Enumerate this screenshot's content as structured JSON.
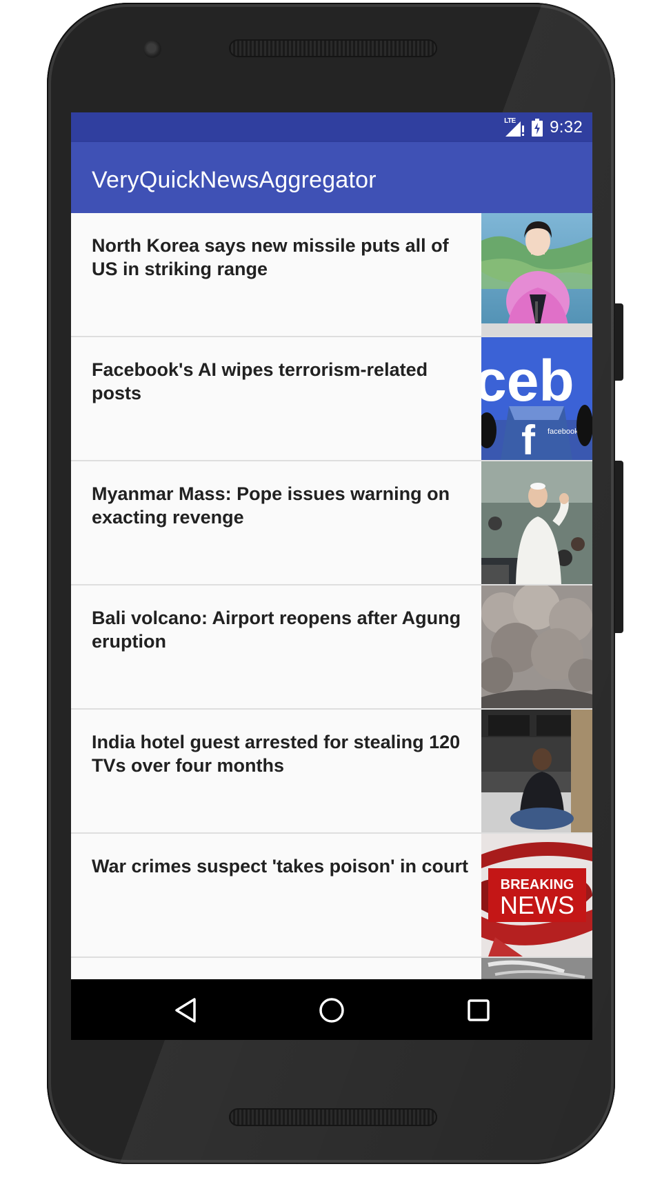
{
  "status_bar": {
    "network_label": "LTE",
    "time": "9:32"
  },
  "app_bar": {
    "title": "VeryQuickNewsAggregator"
  },
  "articles": [
    {
      "headline": "North Korea says new missile puts all of US in striking range",
      "thumbnail": "news-anchor-image"
    },
    {
      "headline": "Facebook's AI wipes terrorism-related posts",
      "thumbnail": "facebook-logo-image"
    },
    {
      "headline": "Myanmar Mass: Pope issues warning on exacting revenge",
      "thumbnail": "pope-image"
    },
    {
      "headline": "Bali volcano: Airport reopens after Agung eruption",
      "thumbnail": "volcano-ash-image"
    },
    {
      "headline": "India hotel guest arrested for stealing 120 TVs over four months",
      "thumbnail": "arrested-man-image"
    },
    {
      "headline": "War crimes suspect 'takes poison' in court",
      "thumbnail": "breaking-news-image"
    },
    {
      "headline": "",
      "thumbnail": "partial-image"
    }
  ],
  "thumbnail_text": {
    "breaking": "BREAKING",
    "news": "NEWS",
    "facebook_big": "ceb",
    "facebook_small": "facebook"
  },
  "nav_bar": {
    "back": "back-icon",
    "home": "home-icon",
    "recents": "recents-icon"
  },
  "colors": {
    "status_bar": "#303f9f",
    "app_bar": "#3f51b5",
    "list_background": "#fafafa",
    "divider": "#dedede",
    "headline_text": "#212121"
  }
}
